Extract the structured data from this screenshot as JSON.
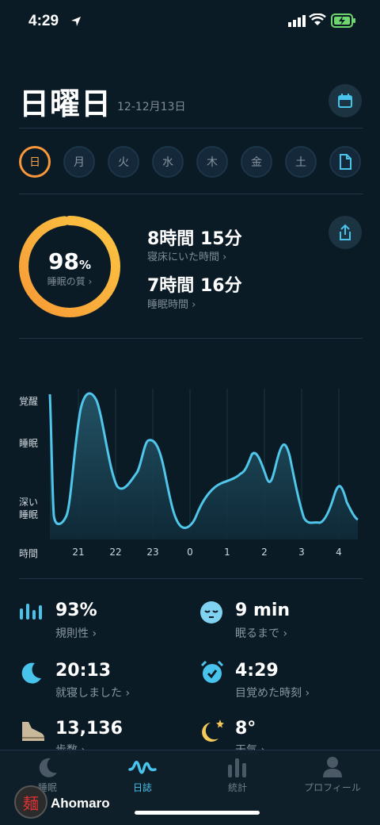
{
  "status_bar": {
    "time": "4:29"
  },
  "header": {
    "day_title": "日曜日",
    "date_range": "12-12月13日"
  },
  "days": [
    "日",
    "月",
    "火",
    "水",
    "木",
    "金",
    "土"
  ],
  "summary": {
    "quality_value": "98",
    "quality_unit": "%",
    "quality_label": "睡眠の質 ›",
    "quality_fraction": 0.98,
    "time_in_bed": "8時間 15分",
    "time_in_bed_label": "寝床にいた時間 ›",
    "sleep_time": "7時間 16分",
    "sleep_time_label": "睡眠時間 ›"
  },
  "chart_data": {
    "type": "area",
    "y_labels": [
      "覚醒",
      "睡眠",
      "深い\n睡眠"
    ],
    "x_title": "時間",
    "x_ticks": [
      "21",
      "22",
      "23",
      "0",
      "1",
      "2",
      "3",
      "4"
    ],
    "note": "",
    "line_color": "#4fc6ea"
  },
  "stats": [
    {
      "value": "93%",
      "label": "規則性 ›",
      "icon": "bars-icon"
    },
    {
      "value": "9 min",
      "label": "眠るまで ›",
      "icon": "sleepy-face-icon"
    },
    {
      "value": "20:13",
      "label": "就寝しました ›",
      "icon": "moon-icon"
    },
    {
      "value": "4:29",
      "label": "目覚めた時刻 ›",
      "icon": "alarm-clock-icon"
    },
    {
      "value": "13,136",
      "label": "歩数 ›",
      "icon": "shoe-icon"
    },
    {
      "value": "8°",
      "label": "天気 ›",
      "icon": "moon-star-icon"
    }
  ],
  "nav": [
    "睡眠",
    "日誌",
    "統計",
    "プロフィール"
  ],
  "overlay": {
    "username": "Ahomaro",
    "avatar_char": "麺"
  },
  "colors": {
    "accent": "#47c3ec",
    "ring": "#f7963a",
    "background": "#0b1b26"
  }
}
